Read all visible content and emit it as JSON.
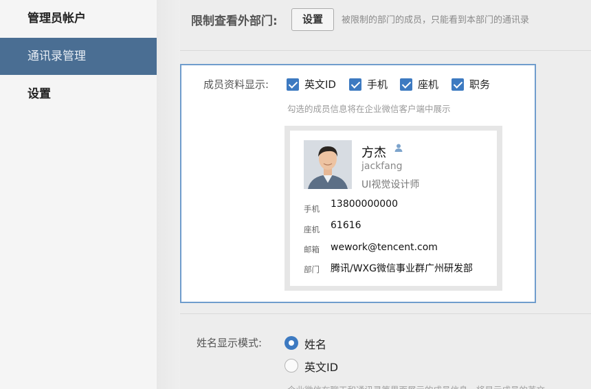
{
  "sidebar": {
    "items": [
      {
        "label": "管理员帐户"
      },
      {
        "label": "通讯录管理",
        "active": true
      },
      {
        "label": "设置"
      }
    ]
  },
  "restrict": {
    "label": "限制查看外部门:",
    "button_label": "设置",
    "description": "被限制的部门的成员，只能看到本部门的通讯录"
  },
  "member_info": {
    "label": "成员资料显示:",
    "options": [
      {
        "label": "英文ID",
        "checked": true
      },
      {
        "label": "手机",
        "checked": true
      },
      {
        "label": "座机",
        "checked": true
      },
      {
        "label": "职务",
        "checked": true
      }
    ],
    "hint": "勾选的成员信息将在企业微信客户端中展示"
  },
  "card": {
    "name": "方杰",
    "english_id": "jackfang",
    "title": "UI视觉设计师",
    "fields": [
      {
        "label": "手机",
        "value": "13800000000"
      },
      {
        "label": "座机",
        "value": "61616"
      },
      {
        "label": "邮箱",
        "value": "wework@tencent.com"
      },
      {
        "label": "部门",
        "value": "腾讯/WXG微信事业群广州研发部"
      }
    ]
  },
  "name_mode": {
    "label": "姓名显示模式:",
    "options": [
      {
        "label": "姓名",
        "selected": true
      },
      {
        "label": "英文ID",
        "selected": false
      }
    ],
    "description": "企业微信在聊天和通讯录等界面展示的成员信息，将显示成员的英文"
  },
  "colors": {
    "accent": "#3d7ac1",
    "sidebar_active": "#4a6e93",
    "panel_border": "#6f9ccc"
  },
  "icons": [
    "person-icon",
    "checkbox-checked",
    "radio-selected",
    "radio-unselected"
  ]
}
